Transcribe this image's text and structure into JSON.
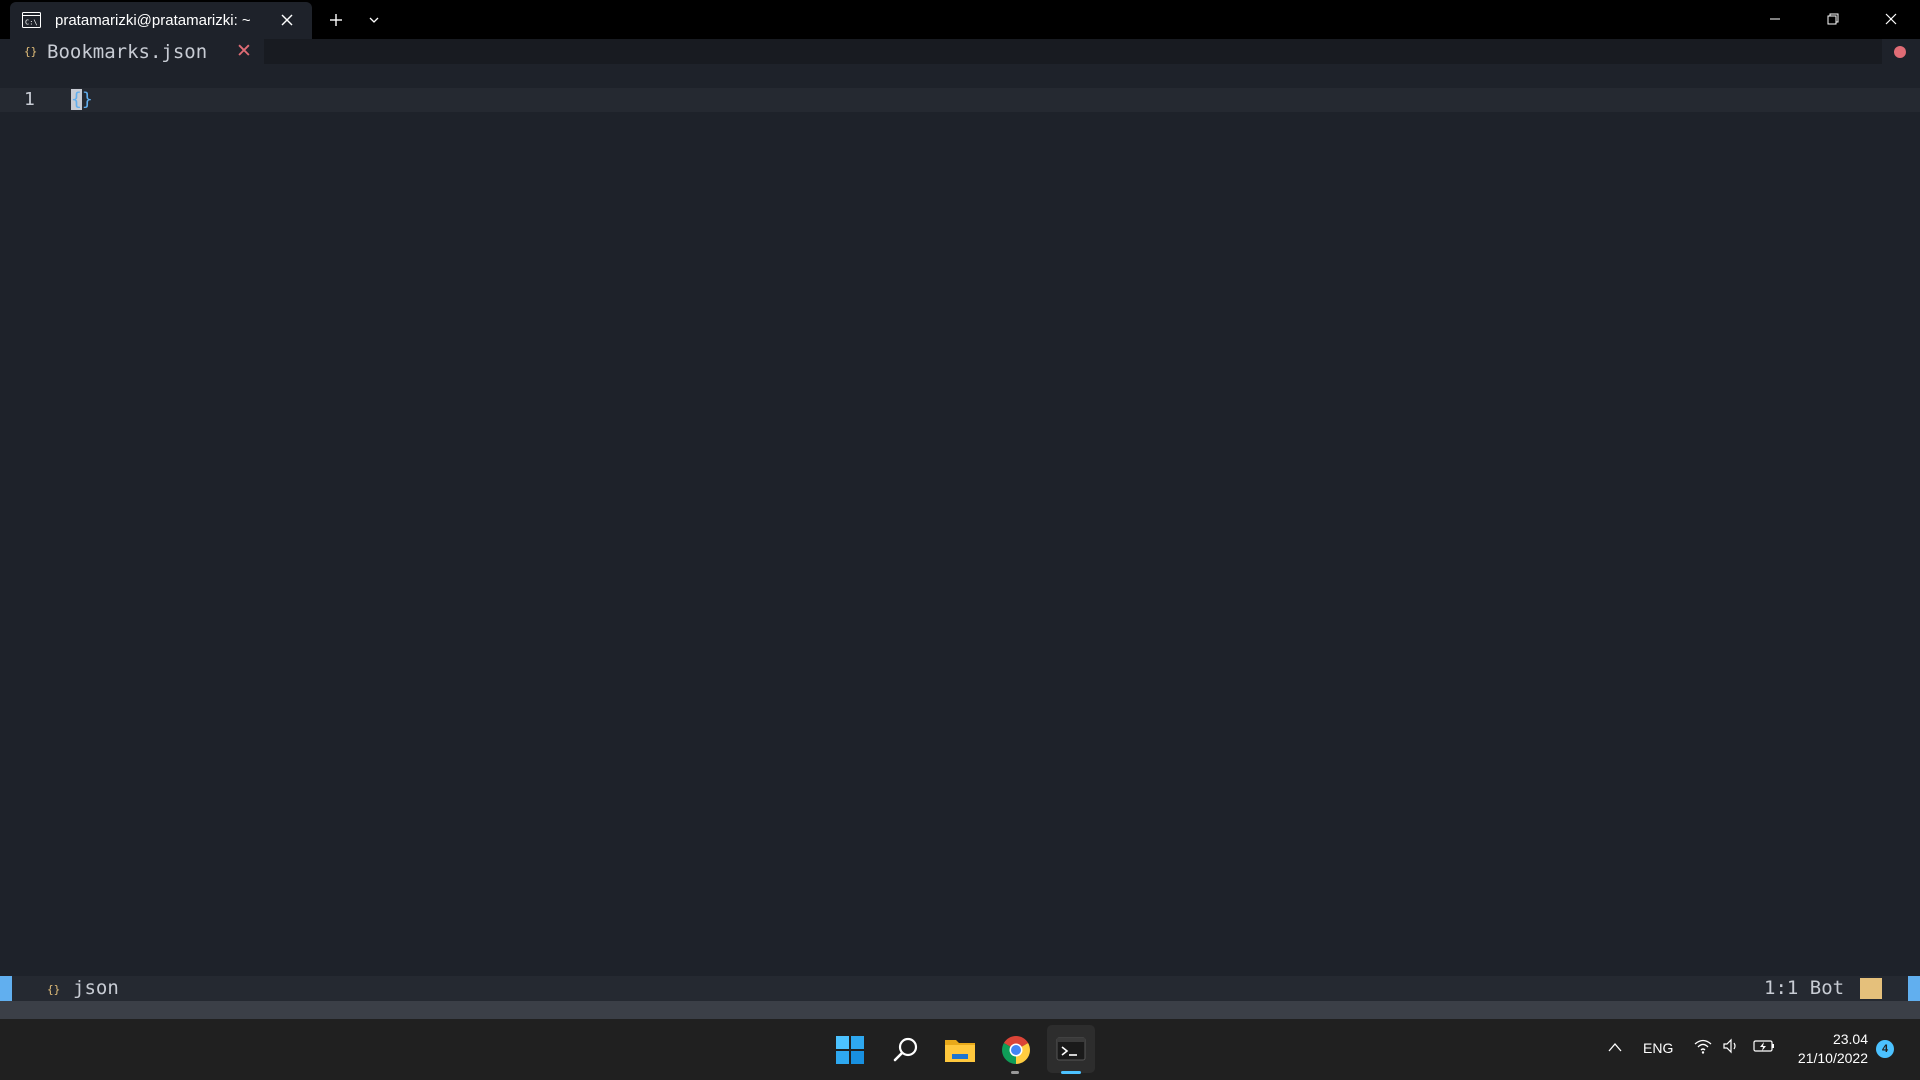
{
  "terminal": {
    "tab_title": "pratamarizki@pratamarizki: ~",
    "icons": {
      "tab": "terminal-icon",
      "close": "close-icon",
      "new_tab": "plus-icon",
      "dropdown": "chevron-down-icon"
    }
  },
  "window_controls": [
    "minimize-icon",
    "restore-icon",
    "close-icon"
  ],
  "editor": {
    "buffer": {
      "icon": "{}",
      "name": "Bookmarks.json",
      "close": "✕"
    },
    "lines": [
      {
        "number": "1",
        "cursor": "{",
        "rest": "}"
      }
    ],
    "statusline": {
      "filetype_icon": "{}",
      "filetype": "json",
      "position": "1:1 Bot"
    },
    "colors": {
      "background": "#1e222a",
      "mode_accent": "#61afef",
      "json_icon": "#e5c07b",
      "close": "#e06c75"
    }
  },
  "taskbar": {
    "apps": [
      "windows-start-icon",
      "search-icon",
      "file-explorer-icon",
      "chrome-icon",
      "terminal-icon"
    ],
    "tray": {
      "language": "ENG",
      "time": "23.04",
      "date": "21/10/2022",
      "notifications": "4"
    }
  }
}
